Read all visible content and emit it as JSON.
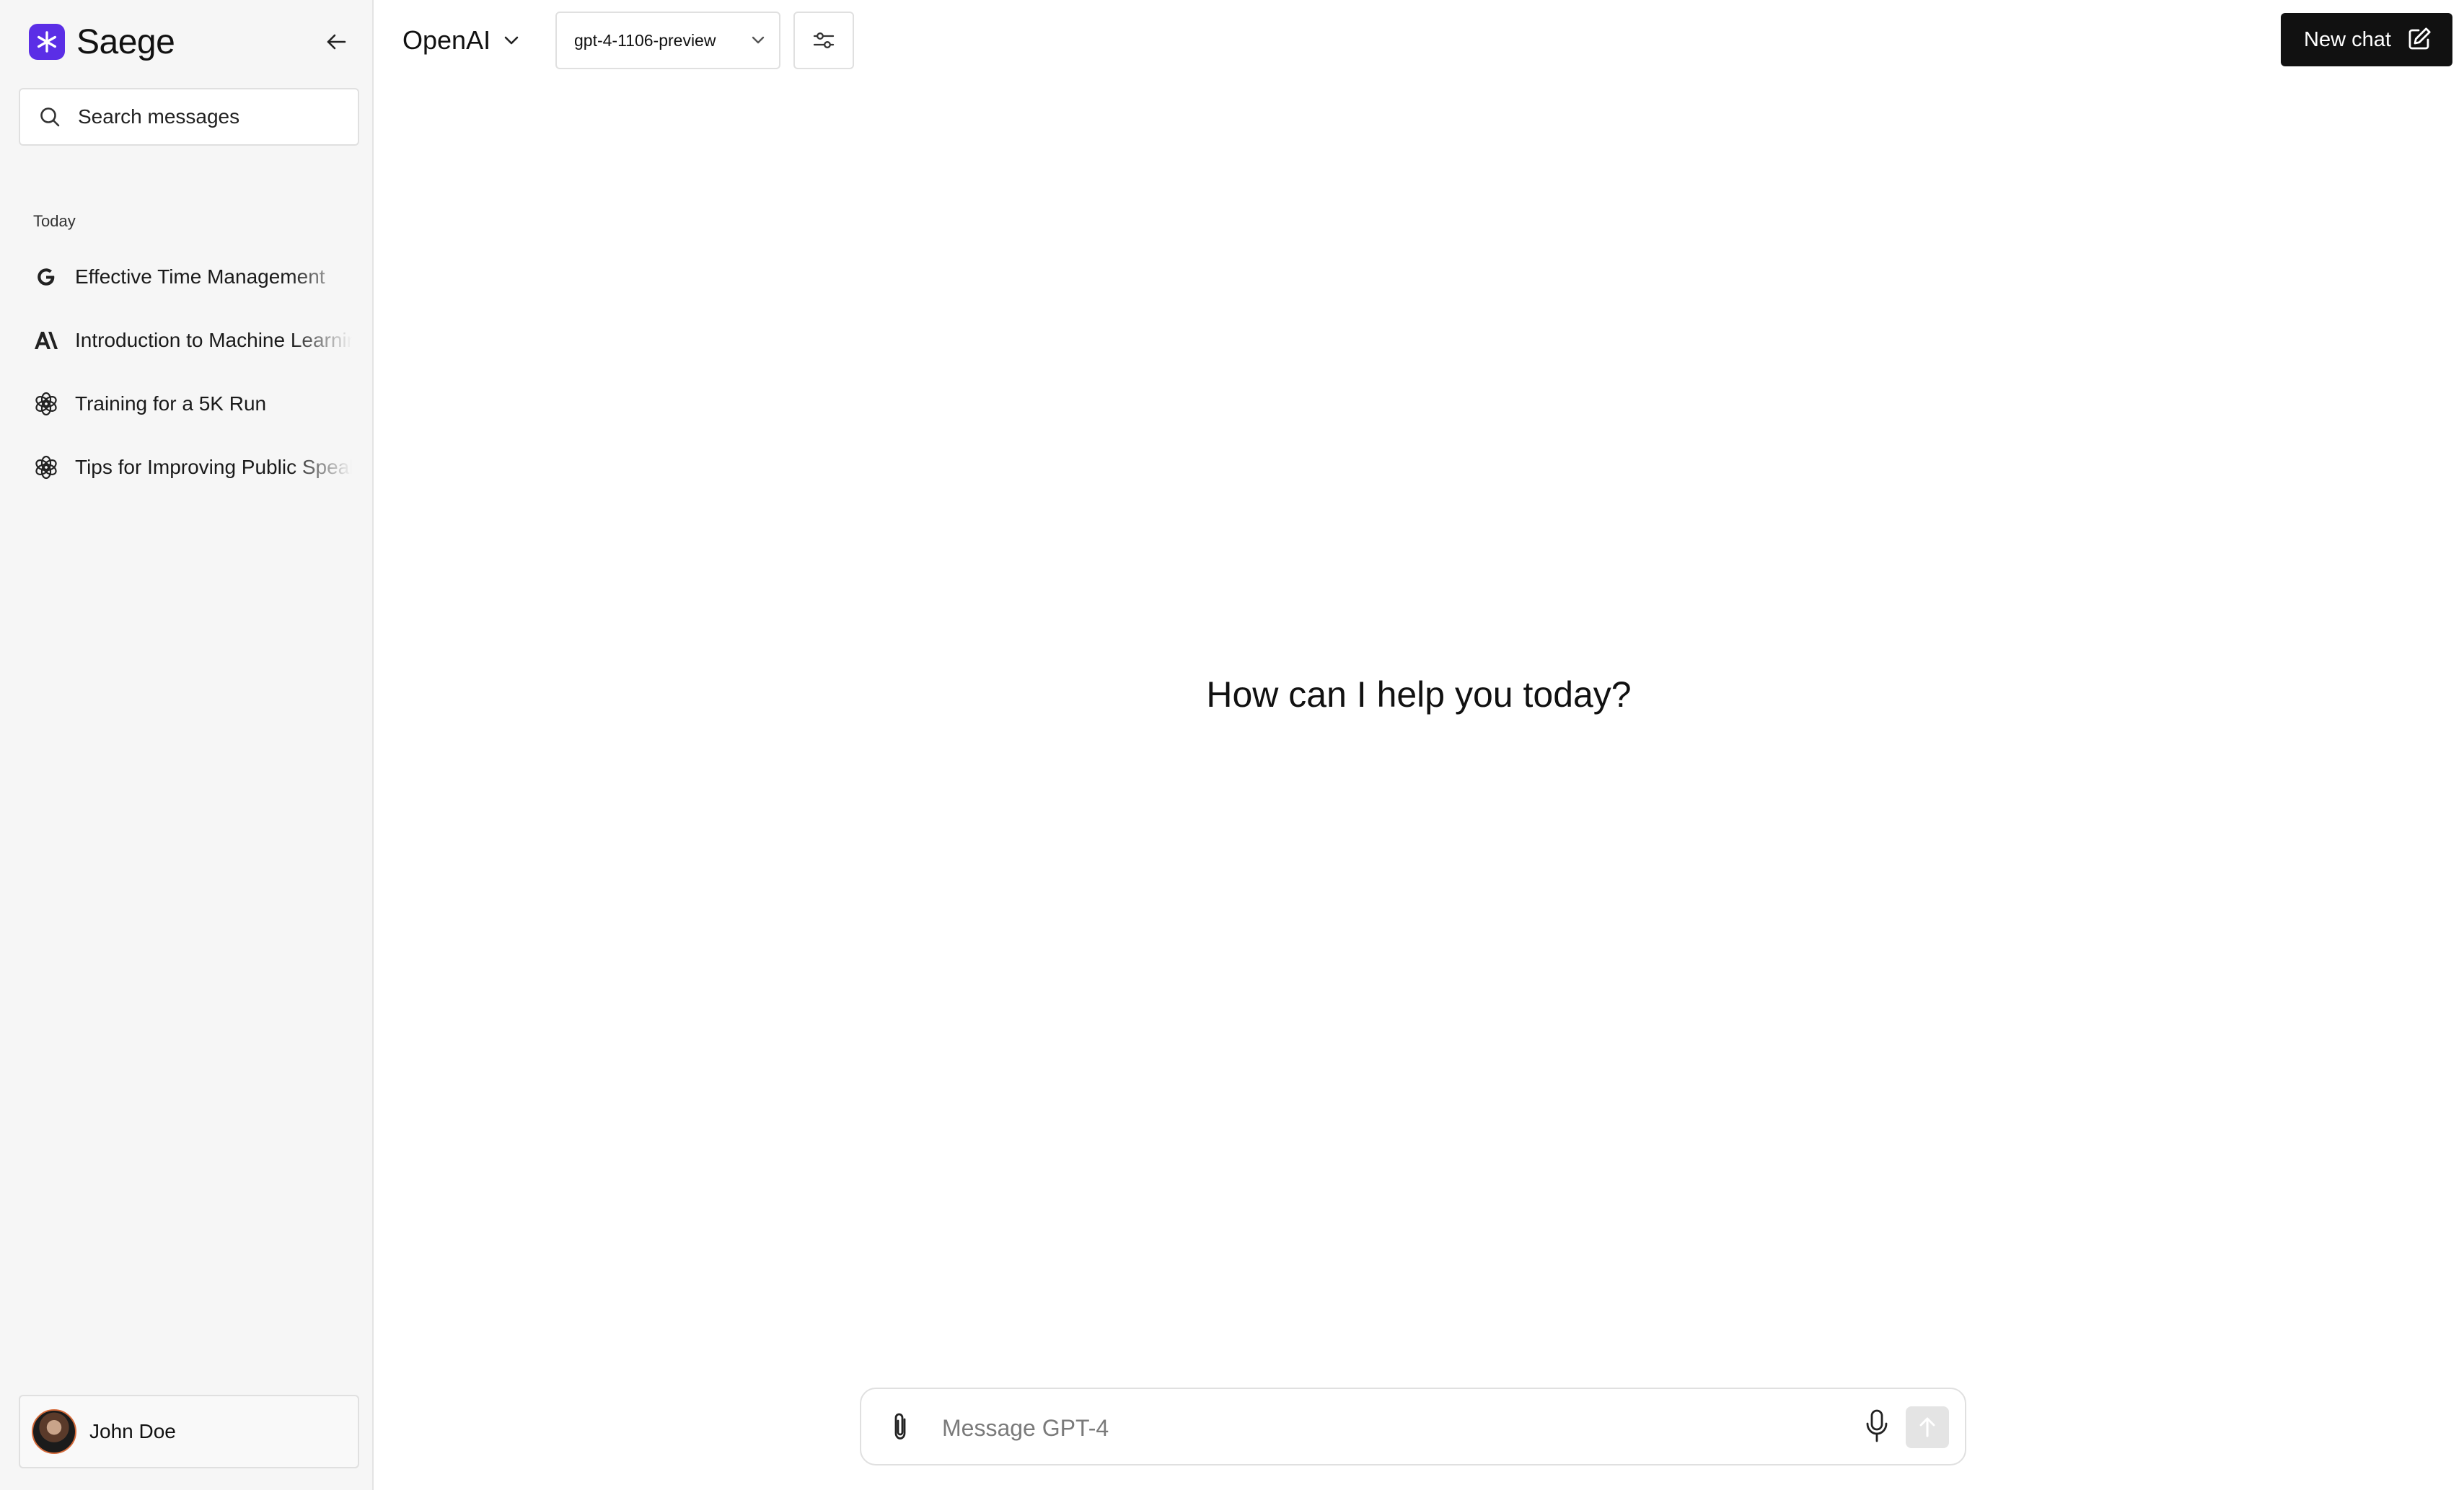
{
  "brand": {
    "name": "Saege",
    "logo_icon": "asterisk-logo-icon",
    "logo_color": "#5b2ee6"
  },
  "sidebar": {
    "search_placeholder": "Search messages",
    "section_label": "Today",
    "chats": [
      {
        "title": "Effective Time Management",
        "provider_icon": "google-icon"
      },
      {
        "title": "Introduction to Machine Learning",
        "provider_icon": "anthropic-icon"
      },
      {
        "title": "Training for a 5K Run",
        "provider_icon": "openai-icon"
      },
      {
        "title": "Tips for Improving Public Speaking",
        "provider_icon": "openai-icon"
      }
    ],
    "user": {
      "name": "John Doe"
    }
  },
  "header": {
    "provider": "OpenAI",
    "model": "gpt-4-1106-preview",
    "new_chat_label": "New chat"
  },
  "main": {
    "greeting": "How can I help you today?"
  },
  "composer": {
    "placeholder": "Message GPT-4"
  }
}
